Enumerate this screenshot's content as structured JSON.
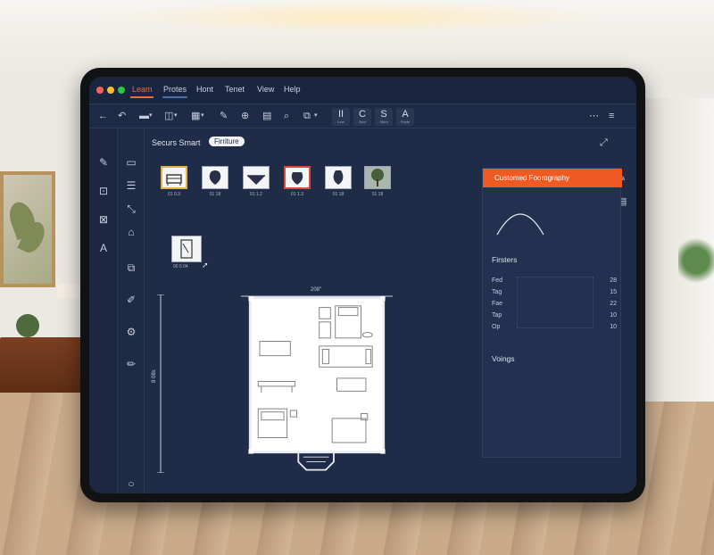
{
  "window": {
    "traffic_colors": [
      "#ff5f57",
      "#ffbd2e",
      "#28c840"
    ]
  },
  "menu": {
    "items": [
      {
        "label": "Leam",
        "active": true
      },
      {
        "label": "Protes",
        "active": false
      },
      {
        "label": "Hont",
        "active": false
      },
      {
        "label": "Tenet",
        "active": false
      },
      {
        "label": "View",
        "active": false
      },
      {
        "label": "Help",
        "active": false
      }
    ]
  },
  "toolbar": {
    "icons": [
      "back-arrow-icon",
      "refresh-icon",
      "folder-icon",
      "chevron-down-icon",
      "layout-icon",
      "chevron-down-icon",
      "grid-icon",
      "chevron-down-icon",
      "pen-icon",
      "globe-icon",
      "clipboard-icon",
      "zoom-icon",
      "crop-icon",
      "chevron-down-icon"
    ],
    "buttons": [
      {
        "big": "II",
        "small": "Line"
      },
      {
        "big": "C",
        "small": "Sect"
      },
      {
        "big": "S",
        "small": "Stent"
      },
      {
        "big": "A",
        "small": "Paste"
      }
    ],
    "right_icons": [
      "dots-icon",
      "menu-icon"
    ]
  },
  "canvas": {
    "title": "Securs Smart",
    "pill": "Firriture",
    "thumbs": [
      {
        "label": "01 0.3",
        "icon": "bed-icon"
      },
      {
        "label": "01 18",
        "icon": "vase-icon"
      },
      {
        "label": "01 1.2",
        "icon": "bowl-icon"
      },
      {
        "label": "01 1.3",
        "icon": "vase-icon"
      },
      {
        "label": "01 18",
        "icon": "vase-icon"
      },
      {
        "label": "01 18",
        "icon": "tree-icon"
      }
    ],
    "selected_object_label": "00 5 04",
    "dim_top": "208\"",
    "dim_left": "8 08s"
  },
  "right_panel": {
    "header": "Customed Foorography",
    "filters_title": "Firsters",
    "rows": [
      {
        "label": "Fed",
        "value": "28"
      },
      {
        "label": "Tag",
        "value": "15"
      },
      {
        "label": "Fae",
        "value": "22"
      },
      {
        "label": "Tap",
        "value": "10"
      },
      {
        "label": "Op",
        "value": "10"
      }
    ],
    "section2": "Voings"
  }
}
